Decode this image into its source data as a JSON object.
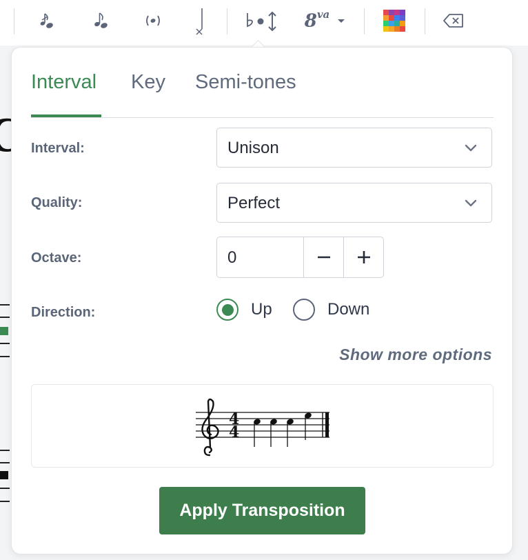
{
  "toolbar": {
    "items": [
      {
        "icon": "grace-note-icon"
      },
      {
        "icon": "eighth-note-icon"
      },
      {
        "icon": "parentheses-note-icon"
      },
      {
        "icon": "stem-direction-icon"
      },
      {
        "icon": "flat-transpose-icon"
      },
      {
        "icon": "ottava-icon",
        "label": "8",
        "superscript": "va"
      },
      {
        "icon": "color-palette-icon"
      },
      {
        "icon": "delete-backspace-icon"
      }
    ]
  },
  "popover": {
    "tabs": [
      {
        "label": "Interval",
        "active": true
      },
      {
        "label": "Key",
        "active": false
      },
      {
        "label": "Semi-tones",
        "active": false
      }
    ],
    "interval": {
      "label": "Interval:",
      "value": "Unison"
    },
    "quality": {
      "label": "Quality:",
      "value": "Perfect"
    },
    "octave": {
      "label": "Octave:",
      "value": "0",
      "decrement": "−",
      "increment": "+"
    },
    "direction": {
      "label": "Direction:",
      "options": [
        {
          "label": "Up",
          "checked": true
        },
        {
          "label": "Down",
          "checked": false
        }
      ]
    },
    "more_options": "Show more options",
    "preview": {
      "clef": "treble",
      "time_signature": "4/4",
      "notes": [
        "C5",
        "C5",
        "C5",
        "E5"
      ]
    },
    "apply_button": "Apply Transposition"
  },
  "colors": {
    "accent": "#3b8a53",
    "button": "#3d7e4c",
    "label": "#5a6578",
    "icon": "#5b6478"
  }
}
